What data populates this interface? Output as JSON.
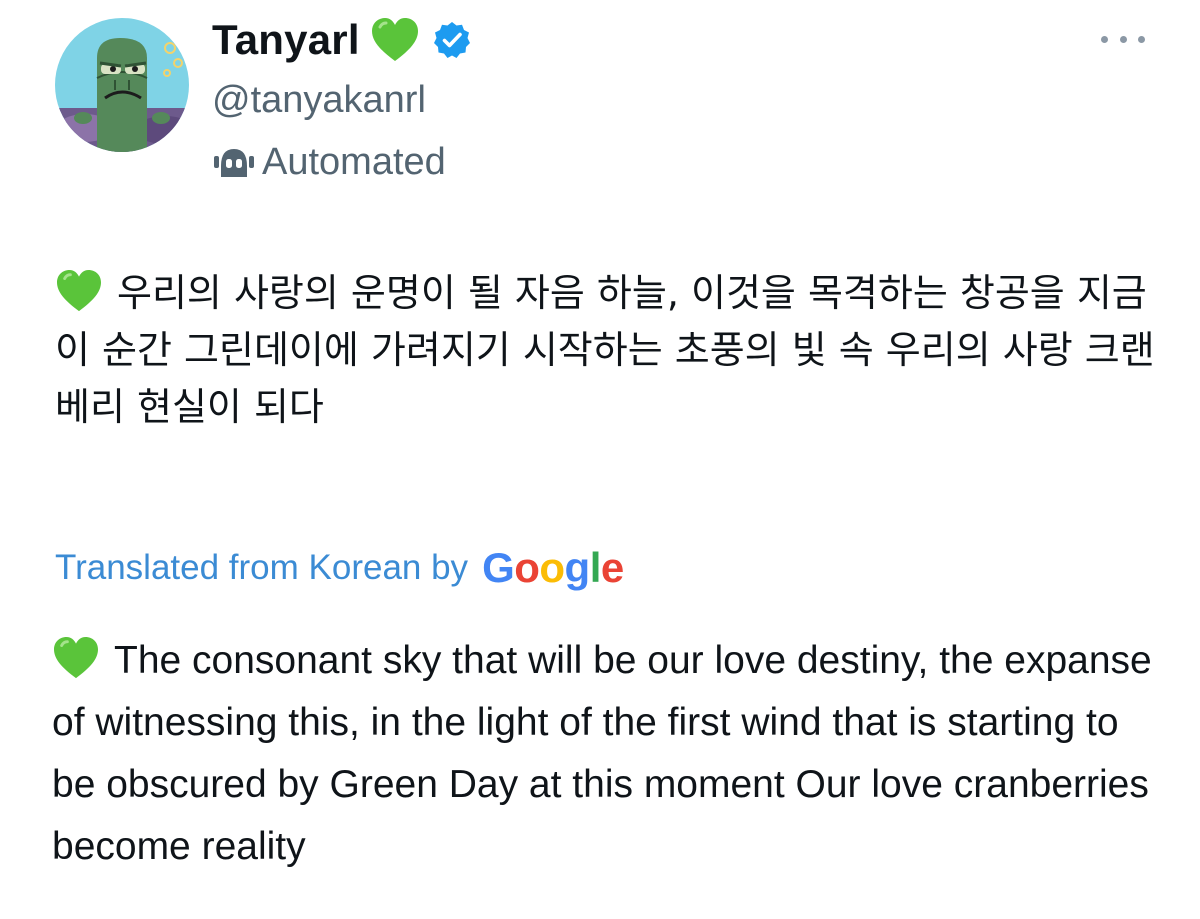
{
  "tweet": {
    "author": {
      "display_name": "Tanyarl",
      "name_emoji": "green-heart",
      "verified": true,
      "handle": "@tanyakanrl",
      "automated_label": "Automated"
    },
    "more_icon": "more-horizontal-icon",
    "original_text": "우리의 사랑의 운명이 될 자음 하늘, 이것을 목격하는 창공을 지금 이 순간 그린데이에 가려지기 시작하는 초풍의 빛 속 우리의 사랑 크랜베리 현실이 되다",
    "translation": {
      "label": "Translated from Korean by",
      "provider_letters": [
        "G",
        "o",
        "o",
        "g",
        "l",
        "e"
      ],
      "text": "The consonant sky that will be our love destiny, the expanse of witnessing this, in the light of the first wind that is starting to be obscured by Green Day at this moment Our love cranberries become reality"
    }
  },
  "colors": {
    "text_primary": "#0f1419",
    "text_secondary": "#536471",
    "link_blue": "#3b8bd4",
    "verified_blue": "#1d9bf0",
    "heart_green": "#5ac43a",
    "google_blue": "#4285f4",
    "google_red": "#ea4335",
    "google_yellow": "#fbbc05",
    "google_green": "#34a853"
  }
}
